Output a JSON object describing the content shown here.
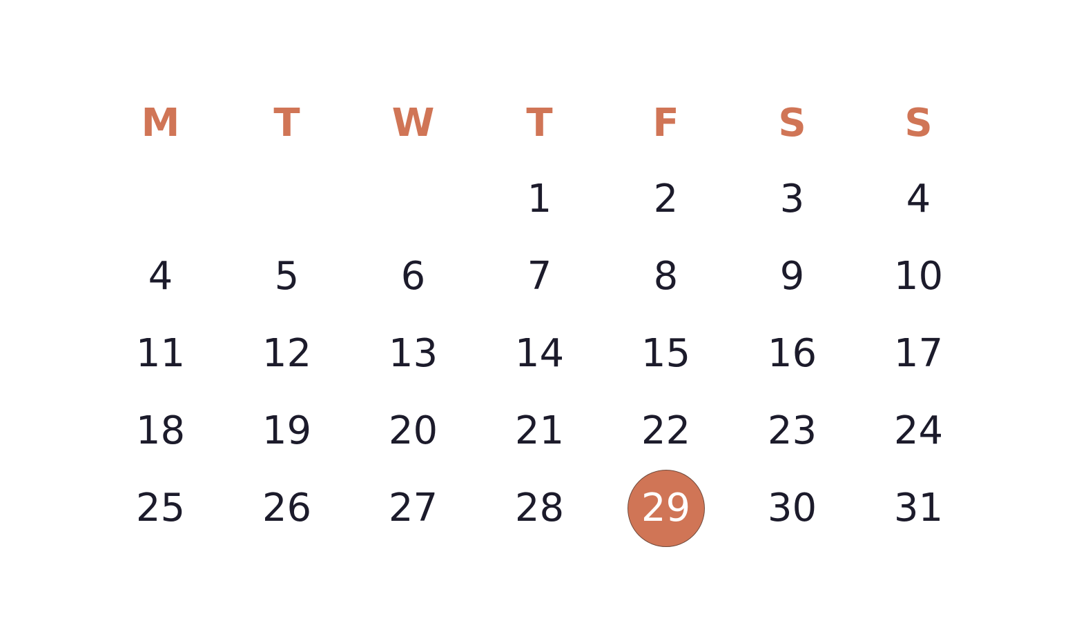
{
  "colors": {
    "accent": "#D07556",
    "text": "#1c1b2b",
    "selected_text": "#ffffff",
    "background": "#ffffff"
  },
  "weekdays": [
    "M",
    "T",
    "W",
    "T",
    "F",
    "S",
    "S"
  ],
  "weeks": [
    [
      "",
      "",
      "",
      "1",
      "2",
      "3",
      "4"
    ],
    [
      "4",
      "5",
      "6",
      "7",
      "8",
      "9",
      "10"
    ],
    [
      "11",
      "12",
      "13",
      "14",
      "15",
      "16",
      "17"
    ],
    [
      "18",
      "19",
      "20",
      "21",
      "22",
      "23",
      "24"
    ],
    [
      "25",
      "26",
      "27",
      "28",
      "29",
      "30",
      "31"
    ]
  ],
  "selected_day": "29"
}
